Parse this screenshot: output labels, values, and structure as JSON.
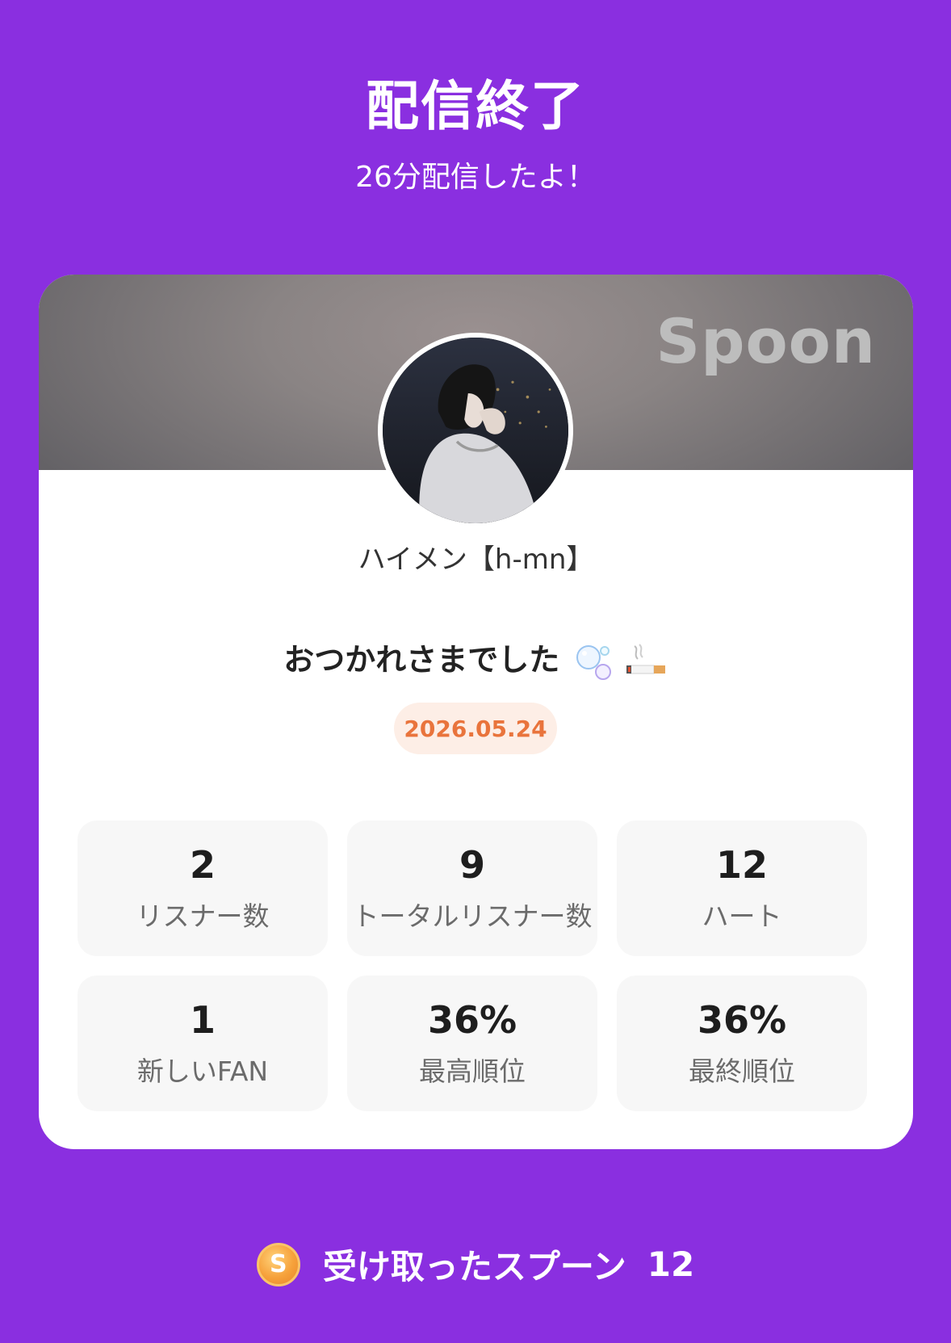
{
  "header": {
    "title": "配信終了",
    "subtitle": "26分配信したよ！"
  },
  "card": {
    "brand": "Spoon",
    "username": "ハイメン【h-mn】",
    "message": "おつかれさまでした",
    "message_emojis": [
      "bubbles-emoji",
      "cigarette-emoji"
    ],
    "date": "2026.05.24",
    "stats": [
      {
        "value": "2",
        "label": "リスナー数"
      },
      {
        "value": "9",
        "label": "トータルリスナー数"
      },
      {
        "value": "12",
        "label": "ハート"
      },
      {
        "value": "1",
        "label": "新しいFAN"
      },
      {
        "value": "36%",
        "label": "最高順位"
      },
      {
        "value": "36%",
        "label": "最終順位"
      }
    ]
  },
  "footer": {
    "coin_letter": "S",
    "label": "受け取ったスプーン",
    "count": "12"
  },
  "colors": {
    "background": "#8a2fe0",
    "date_text": "#e9743c",
    "date_bg": "#fdeee6",
    "coin": "#f6a13b"
  }
}
